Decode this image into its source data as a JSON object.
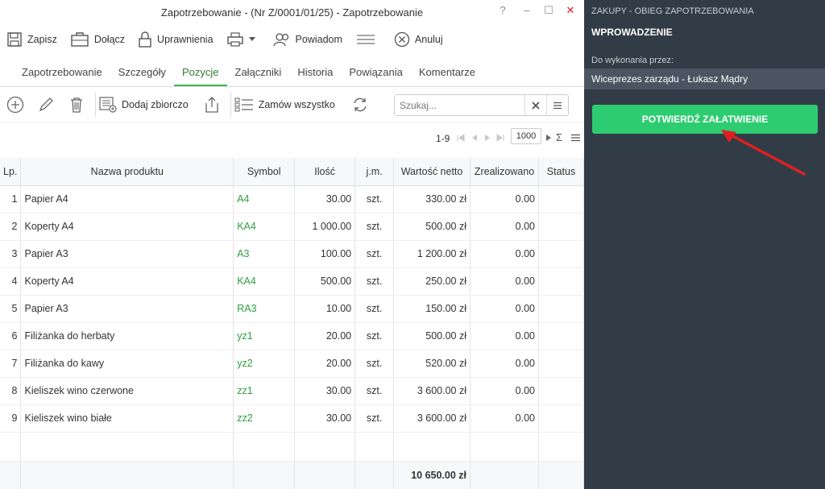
{
  "window": {
    "title": "Zapotrzebowanie - (Nr Z/0001/01/25) - Zapotrzebowanie",
    "help": "?",
    "minimize": "–",
    "maximize": "☐",
    "close": "✕"
  },
  "toolbar": {
    "save": "Zapisz",
    "attach": "Dołącz",
    "permissions": "Uprawnienia",
    "notify": "Powiadom",
    "cancel": "Anuluj"
  },
  "tabs": [
    "Zapotrzebowanie",
    "Szczegóły",
    "Pozycje",
    "Załączniki",
    "Historia",
    "Powiązania",
    "Komentarze"
  ],
  "actionbar": {
    "bulk_add": "Dodaj zbiorczo",
    "order_all": "Zamów wszystko",
    "search_placeholder": "Szukaj..."
  },
  "pager": {
    "range": "1-9",
    "page_size": "1000",
    "sum_symbol": "Σ"
  },
  "table": {
    "columns": [
      "Lp.",
      "Nazwa produktu",
      "Symbol",
      "Ilość",
      "j.m.",
      "Wartość netto",
      "Zrealizowano",
      "Status"
    ],
    "rows": [
      {
        "lp": "1",
        "name": "Papier A4",
        "symbol": "A4",
        "qty": "30.00",
        "unit": "szt.",
        "net": "330.00 zł",
        "done": "0.00",
        "status": ""
      },
      {
        "lp": "2",
        "name": "Koperty A4",
        "symbol": "KA4",
        "qty": "1 000.00",
        "unit": "szt.",
        "net": "500.00 zł",
        "done": "0.00",
        "status": ""
      },
      {
        "lp": "3",
        "name": "Papier A3",
        "symbol": "A3",
        "qty": "100.00",
        "unit": "szt.",
        "net": "1 200.00 zł",
        "done": "0.00",
        "status": ""
      },
      {
        "lp": "4",
        "name": "Koperty A4",
        "symbol": "KA4",
        "qty": "500.00",
        "unit": "szt.",
        "net": "250.00 zł",
        "done": "0.00",
        "status": ""
      },
      {
        "lp": "5",
        "name": "Papier A3",
        "symbol": "RA3",
        "qty": "10.00",
        "unit": "szt.",
        "net": "150.00 zł",
        "done": "0.00",
        "status": ""
      },
      {
        "lp": "6",
        "name": "Filiżanka do herbaty",
        "symbol": "yz1",
        "qty": "20.00",
        "unit": "szt.",
        "net": "500.00 zł",
        "done": "0.00",
        "status": ""
      },
      {
        "lp": "7",
        "name": "Filiżanka do kawy",
        "symbol": "yz2",
        "qty": "20.00",
        "unit": "szt.",
        "net": "520.00 zł",
        "done": "0.00",
        "status": ""
      },
      {
        "lp": "8",
        "name": "Kieliszek wino czerwone",
        "symbol": "zz1",
        "qty": "30.00",
        "unit": "szt.",
        "net": "3 600.00 zł",
        "done": "0.00",
        "status": ""
      },
      {
        "lp": "9",
        "name": "Kieliszek wino białe",
        "symbol": "zz2",
        "qty": "30.00",
        "unit": "szt.",
        "net": "3 600.00 zł",
        "done": "0.00",
        "status": ""
      }
    ],
    "total_net": "10 650.00 zł"
  },
  "right_panel": {
    "category": "ZAKUPY - OBIEG ZAPOTRZEBOWANIA",
    "stage": "WPROWADZENIE",
    "assignee_label": "Do wykonania przez:",
    "assignee": "Wiceprezes zarządu - Łukasz Mądry",
    "confirm_button": "POTWIERDŹ ZAŁATWIENIE"
  },
  "colors": {
    "panel_bg": "#323c47",
    "confirm_green": "#2ecc71",
    "active_tab": "#3cb54a",
    "arrow_red": "#e02020"
  }
}
